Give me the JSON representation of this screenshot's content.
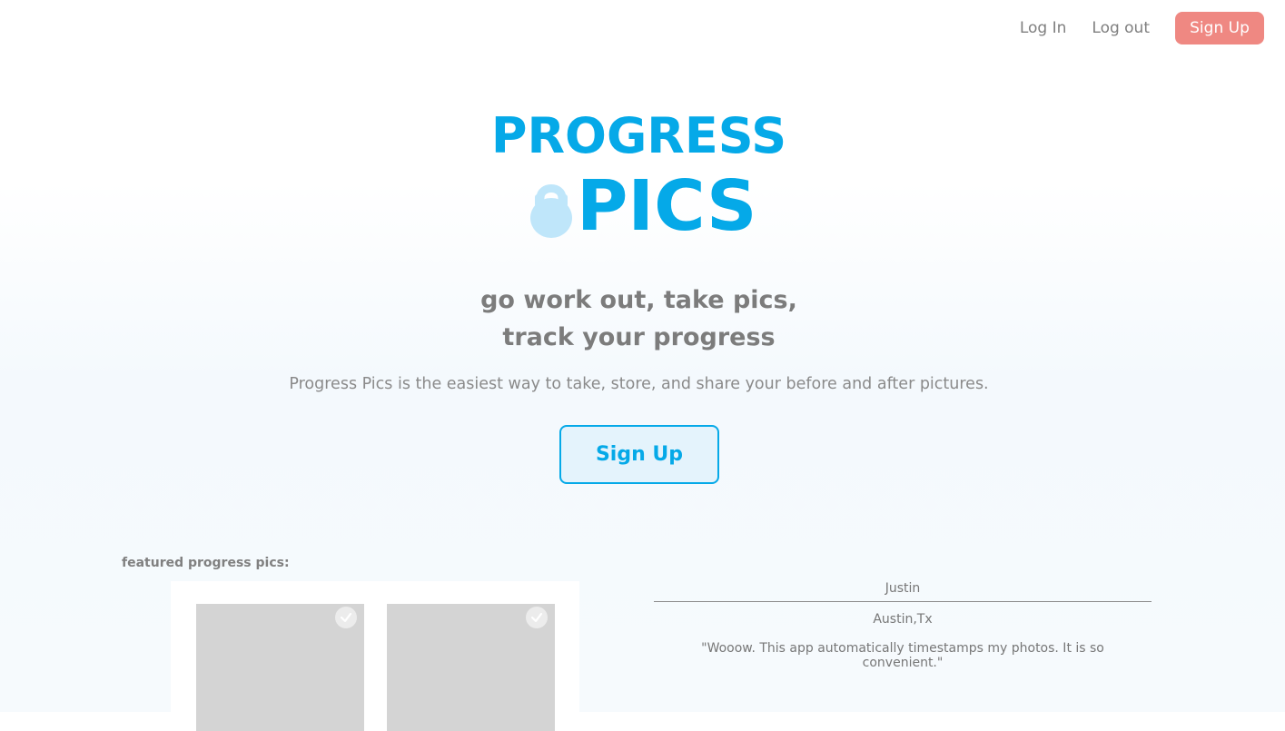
{
  "nav": {
    "login_label": "Log In",
    "logout_label": "Log out",
    "signup_label": "Sign Up"
  },
  "logo": {
    "line1": "PROGRESS",
    "line2": "PICS",
    "icon": "kettlebell-icon"
  },
  "hero": {
    "tagline_line1": "go work out, take pics,",
    "tagline_line2": "track your progress",
    "description": "Progress Pics is the easiest way to take, store, and share your before and after pictures.",
    "cta_label": "Sign Up"
  },
  "featured": {
    "label": "featured progress pics:",
    "photos": [
      {
        "icon": "check-icon"
      },
      {
        "icon": "check-icon"
      }
    ]
  },
  "testimonial": {
    "name": "Justin",
    "location": "Austin,Tx",
    "quote": "\"Wooow. This app automatically timestamps my photos. It is so convenient.\""
  },
  "colors": {
    "brand_blue": "#05a9e8",
    "signup_coral": "#ef8882",
    "text_gray": "#7c7c7c",
    "kettlebell_light_blue": "#bfe6fa"
  }
}
